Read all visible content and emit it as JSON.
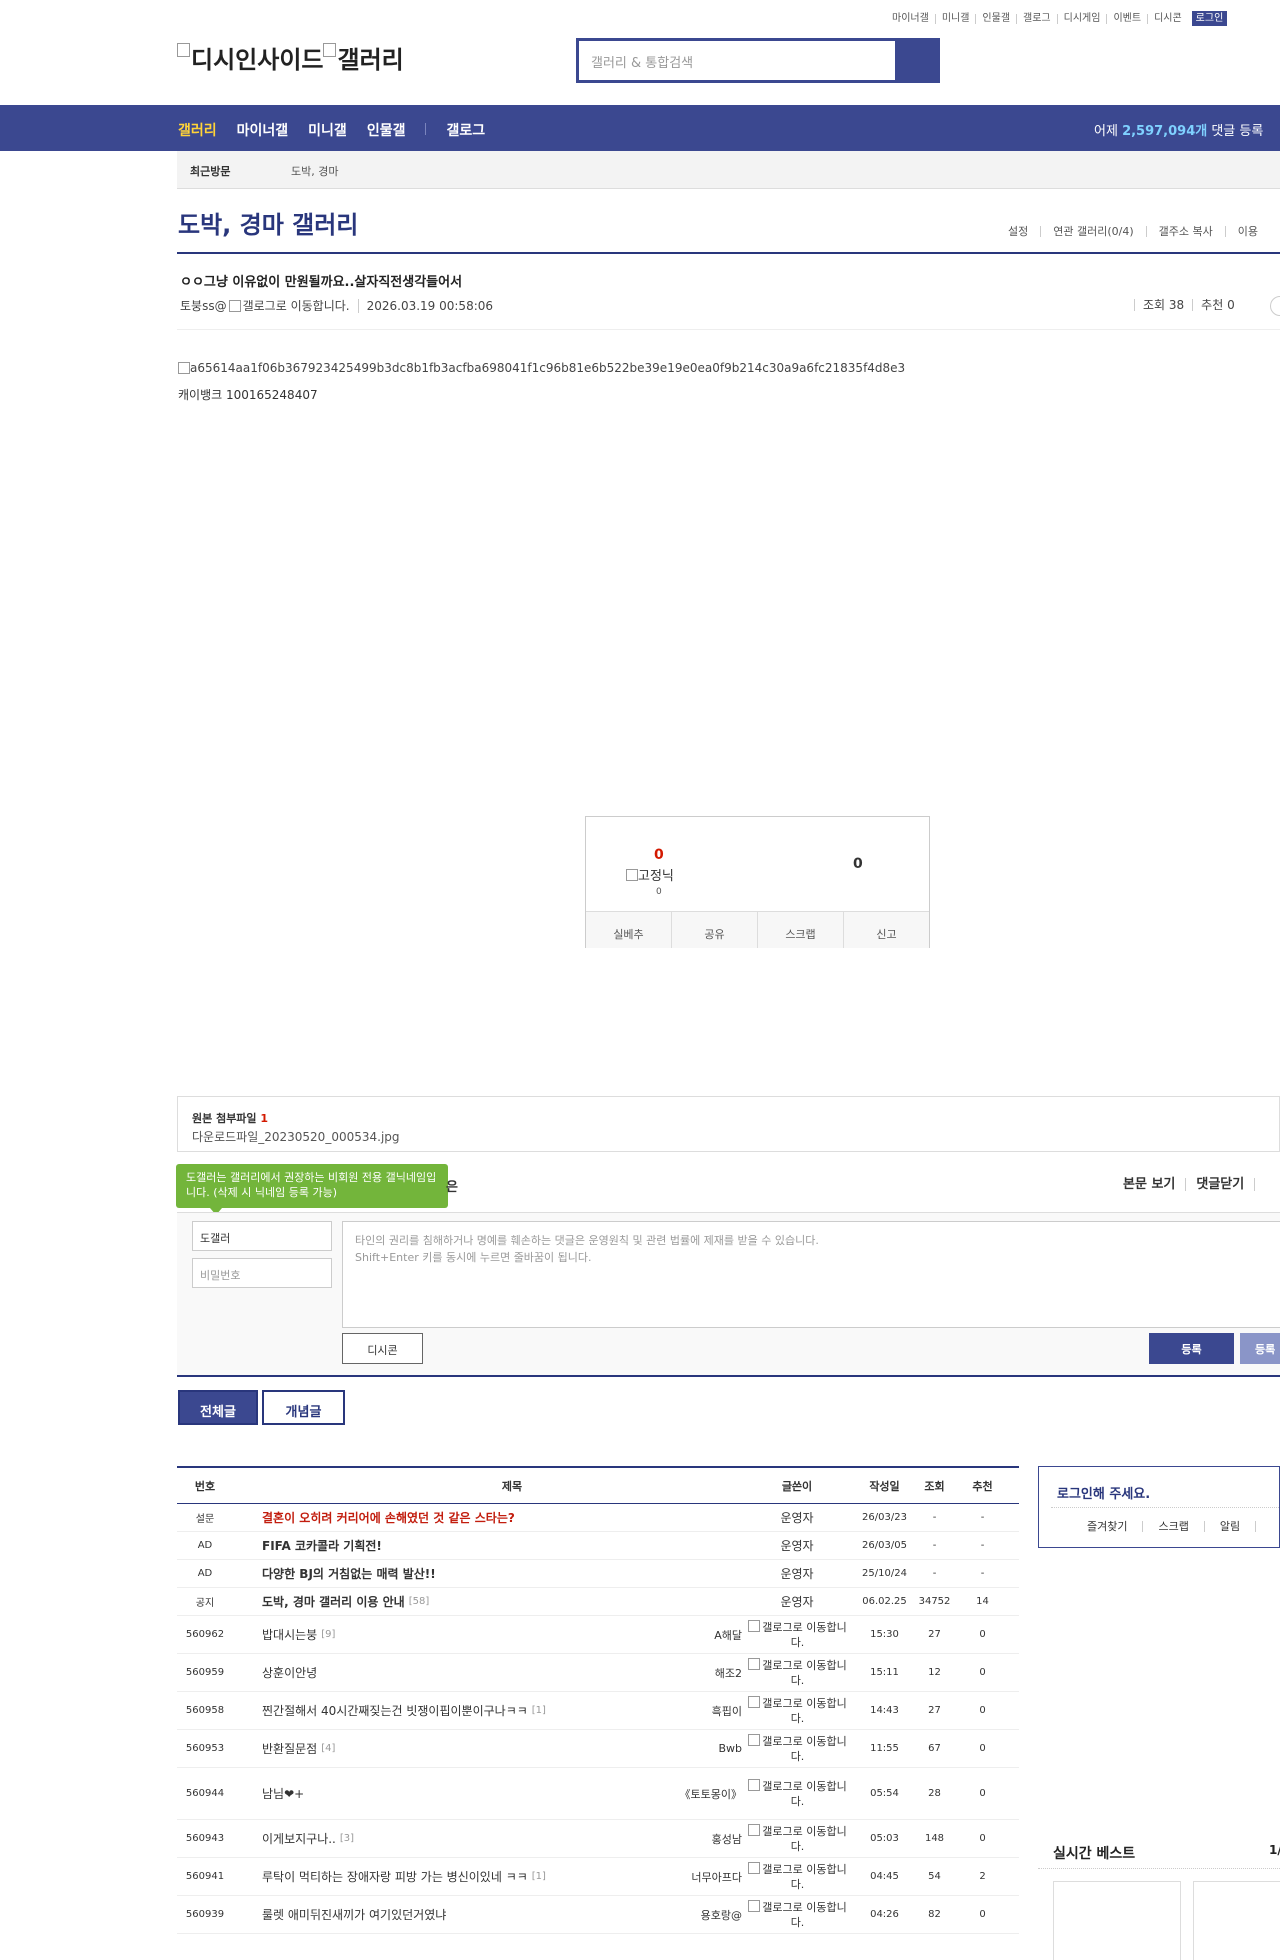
{
  "util": {
    "items": [
      "마이너갤",
      "미니갤",
      "인물갤",
      "갤로그",
      "디시게임",
      "이벤트",
      "디시콘"
    ],
    "login": "로그인"
  },
  "logo": {
    "main": "디시인사이드",
    "sub": "갤러리"
  },
  "search": {
    "placeholder": "갤러리 & 통합검색"
  },
  "gnb": {
    "menu": [
      "갤러리",
      "마이너갤",
      "미니갤",
      "인물갤",
      "갤로그"
    ],
    "stat_prefix": "어제 ",
    "stat_value": "2,597,094개",
    "stat_suffix": " 댓글 등록"
  },
  "recent": {
    "label": "최근방문",
    "value": "도박, 경마"
  },
  "gallery": {
    "title": "도박, 경마 갤러리",
    "options": [
      "설정",
      "연관 갤러리(0/4)",
      "갤주소 복사",
      "이용"
    ]
  },
  "post": {
    "title": "ㅇㅇ그냥 이유없이 만원될까요..살자직전생각들어서",
    "writer": "토붕ss@",
    "writer_img_alt": "갤로그로 이동합니다.",
    "date": "2026.03.19 00:58:06",
    "views": "조회 38",
    "recommends": "추천 0",
    "image_alt": "a65614aa1f06b367923425499b3dc8b1fb3acfba698041f1c96b81e6b522be39e19e0ea0f9b214c30a9a6fc21835f4d8e3",
    "body_text": "캐이뱅크 100165248407"
  },
  "recommend": {
    "up_count": "0",
    "fixed_label": "고정닉",
    "fixed_count": "0",
    "down_count": "0",
    "buttons": [
      "실베추",
      "공유",
      "스크랩",
      "신고"
    ]
  },
  "attachment": {
    "label": "원본 첨부파일",
    "count": "1",
    "file": "다운로드파일_20230520_000534.jpg"
  },
  "comment": {
    "tooltip": "도갤러는 갤러리에서 권장하는 비회원 전용 갤닉네임입니다. (삭제 시 닉네임 등록 가능)",
    "tooltip_tail": "은",
    "menu": [
      "본문 보기",
      "댓글닫기"
    ],
    "nick": "도갤러",
    "password_placeholder": "비밀번호",
    "textarea_line1": "타인의 권리를 침해하거나 명예를 훼손하는 댓글은 운영원칙 및 관련 법률에 제재를 받을 수 있습니다.",
    "textarea_line2": "Shift+Enter 키를 동시에 누르면 줄바꿈이 됩니다.",
    "dccon": "디시콘",
    "submit": "등록",
    "submit2": "등록"
  },
  "tabs": [
    "전체글",
    "개념글"
  ],
  "list": {
    "headers": [
      "번호",
      "제목",
      "글쓴이",
      "작성일",
      "조회",
      "추천"
    ],
    "rows": [
      {
        "num": "설문",
        "title": "결혼이 오히려 커리어에 손해였던 것 같은 스타는?",
        "reply": "",
        "writer": "운영자",
        "date": "26/03/23",
        "views": "-",
        "rec": "-",
        "type": "notice-red"
      },
      {
        "num": "AD",
        "title": "FIFA 코카콜라 기획전!",
        "reply": "",
        "writer": "운영자",
        "date": "26/03/05",
        "views": "-",
        "rec": "-",
        "type": "notice"
      },
      {
        "num": "AD",
        "title": "다양한 BJ의 거침없는 매력 발산!!",
        "reply": "",
        "writer": "운영자",
        "date": "25/10/24",
        "views": "-",
        "rec": "-",
        "type": "notice"
      },
      {
        "num": "공지",
        "title": "도박, 경마 갤러리 이용 안내",
        "reply": "[58]",
        "writer": "운영자",
        "date": "06.02.25",
        "views": "34752",
        "rec": "14",
        "type": "notice"
      },
      {
        "num": "560962",
        "title": "밥대시는붕",
        "reply": "[9]",
        "writer": "A해달",
        "galog": "갤로그로 이동합니다.",
        "date": "15:30",
        "views": "27",
        "rec": "0"
      },
      {
        "num": "560959",
        "title": "상훈이안녕",
        "reply": "",
        "writer": "해조2",
        "galog": "갤로그로 이동합니다.",
        "date": "15:11",
        "views": "12",
        "rec": "0"
      },
      {
        "num": "560958",
        "title": "찐간절해서 40시간째짖는건 빗쟁이핍이뿐이구나ㅋㅋ",
        "reply": "[1]",
        "writer": "흑핍이",
        "galog": "갤로그로 이동합니다.",
        "date": "14:43",
        "views": "27",
        "rec": "0"
      },
      {
        "num": "560953",
        "title": "반환질문점",
        "reply": "[4]",
        "writer": "Bwb",
        "galog": "갤로그로 이동합니다.",
        "date": "11:55",
        "views": "67",
        "rec": "0"
      },
      {
        "num": "560944",
        "title": "남님❤+",
        "reply": "",
        "writer": "《토토몽이》",
        "galog": "갤로그로 이동합니다.",
        "date": "05:54",
        "views": "28",
        "rec": "0"
      },
      {
        "num": "560943",
        "title": "이게보지구나..",
        "reply": "[3]",
        "writer": "홍성남",
        "galog": "갤로그로 이동합니다.",
        "date": "05:03",
        "views": "148",
        "rec": "0"
      },
      {
        "num": "560941",
        "title": "루탁이 먹티하는 장애자랑 피방 가는 병신이있네 ㅋㅋ",
        "reply": "[1]",
        "writer": "너무아프다",
        "galog": "갤로그로 이동합니다.",
        "date": "04:45",
        "views": "54",
        "rec": "2"
      },
      {
        "num": "560939",
        "title": "룰렛 애미뒤진새끼가 여기있던거였냐",
        "reply": "",
        "writer": "용호랑@",
        "galog": "갤로그로 이동합니다.",
        "date": "04:26",
        "views": "82",
        "rec": "0"
      }
    ]
  },
  "side": {
    "login_title": "로그인해 주세요.",
    "links": [
      "즐겨찾기",
      "스크랩",
      "알림"
    ],
    "best_title": "실시간 베스트",
    "best_page": "1/"
  }
}
